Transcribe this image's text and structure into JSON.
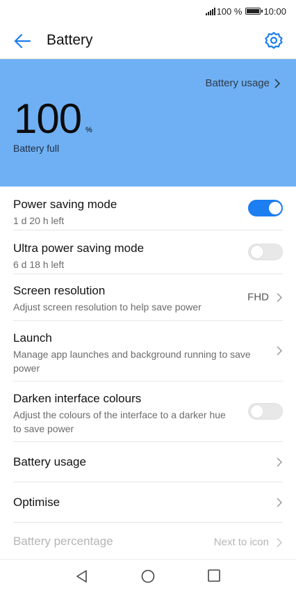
{
  "status_bar": {
    "battery_percent": "100 %",
    "time": "10:00"
  },
  "app_bar": {
    "title": "Battery",
    "back_icon": "arrow-left-icon",
    "settings_icon": "gear-icon"
  },
  "hero": {
    "usage_link": "Battery usage",
    "level_value": "100",
    "level_unit": "%",
    "status": "Battery full",
    "background_color": "#6fb0f4"
  },
  "settings": [
    {
      "title": "Power saving mode",
      "subtitle": "1 d 20 h left",
      "control": "toggle",
      "on": true
    },
    {
      "title": "Ultra power saving mode",
      "subtitle": "6 d 18 h left",
      "control": "toggle",
      "on": false
    },
    {
      "title": "Screen resolution",
      "subtitle": "Adjust screen resolution to help save power",
      "control": "chevron",
      "value": "FHD"
    },
    {
      "title": "Launch",
      "subtitle": "Manage app launches and background running to save power",
      "control": "chevron"
    },
    {
      "title": "Darken interface colours",
      "subtitle": "Adjust the colours of the interface to a darker hue to save power",
      "control": "toggle",
      "on": false
    },
    {
      "title": "Battery usage",
      "control": "chevron"
    },
    {
      "title": "Optimise",
      "control": "chevron"
    },
    {
      "title": "Battery percentage",
      "control": "chevron",
      "value": "Next to icon",
      "disabled": true
    }
  ],
  "accent_color": "#1c7ef0",
  "nav_bar": {
    "back_icon": "triangle-back-icon",
    "home_icon": "circle-home-icon",
    "recents_icon": "square-recents-icon"
  }
}
